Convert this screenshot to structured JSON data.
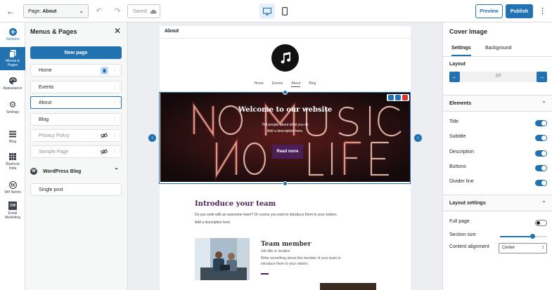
{
  "topbar": {
    "page_select_label": "Page:",
    "page_select_value": "About",
    "saved_label": "Saved",
    "preview_label": "Preview",
    "publish_label": "Publish"
  },
  "rail": {
    "items": [
      {
        "label": "Sections",
        "icon": "plus-circle-icon"
      },
      {
        "label": "Menus & Pages",
        "icon": "pages-icon"
      },
      {
        "label": "Appearance",
        "icon": "palette-icon"
      },
      {
        "label": "Settings",
        "icon": "gear-icon"
      },
      {
        "label": "Blog",
        "icon": "blog-icon"
      },
      {
        "label": "Bluehost India",
        "icon": "grid-icon"
      },
      {
        "label": "WP Admin",
        "icon": "wordpress-icon"
      },
      {
        "label": "Email Marketing",
        "icon": "cm-icon"
      }
    ]
  },
  "panel": {
    "title": "Menus & Pages",
    "new_page_label": "New page",
    "pages": [
      {
        "label": "Home"
      },
      {
        "label": "Events"
      },
      {
        "label": "About"
      },
      {
        "label": "Blog"
      },
      {
        "label": "Privacy Policy"
      },
      {
        "label": "Sample Page"
      }
    ],
    "wp_blog_label": "WordPress Blog",
    "wp_pages": [
      {
        "label": "Single post"
      }
    ]
  },
  "canvas": {
    "page_heading": "About",
    "nav": [
      "Home",
      "Events",
      "About",
      "Blog"
    ],
    "cover_title": "Welcome to our website",
    "cover_subtitle": "Tell people about what you do",
    "cover_description": "Add a description here.",
    "cover_button": "Read more",
    "team_title": "Introduce your team",
    "team_intro_1": "Do you work with an awesome team? Or course you want to introduce them to your visitors.",
    "team_intro_2": "Add a description here.",
    "member_name": "Team member",
    "member_job": "Job title or location",
    "member_desc": "Write something about this member of your team to introduce them to your visitors."
  },
  "rpanel": {
    "title": "Cover Image",
    "tabs": [
      "Settings",
      "Background"
    ],
    "layout_label": "Layout",
    "layout_value": "7/7",
    "elements_label": "Elements",
    "elements": [
      {
        "label": "Title",
        "on": true
      },
      {
        "label": "Subtitle",
        "on": true
      },
      {
        "label": "Description",
        "on": true
      },
      {
        "label": "Buttons",
        "on": true
      },
      {
        "label": "Divider line",
        "on": true
      }
    ],
    "layout_settings_label": "Layout settings",
    "full_page_label": "Full page",
    "full_page_on": false,
    "section_size_label": "Section size",
    "section_size_value": 0.68,
    "content_alignment_label": "Content alignment",
    "content_alignment_value": "Center"
  },
  "colors": {
    "accent": "#2271b1",
    "brand_purple": "#4a1f57"
  }
}
